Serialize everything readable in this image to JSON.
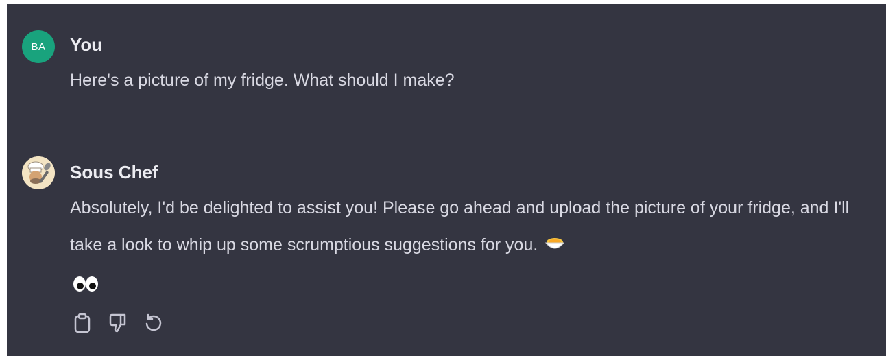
{
  "messages": {
    "user": {
      "avatar_initials": "BA",
      "author": "You",
      "text": "Here's a picture of my fridge. What should I make?"
    },
    "bot": {
      "author": "Sous Chef",
      "text": "Absolutely, I'd be delighted to assist you! Please go ahead and upload the picture of your fridge, and I'll take a look to whip up some scrumptious suggestions for you.",
      "emoji_inline": "cooking-bowl-emoji",
      "emoji_after": "eyes-emoji"
    }
  },
  "actions": [
    "copy-icon",
    "thumbs-down-icon",
    "regenerate-icon"
  ],
  "colors": {
    "panel_background": "#343541",
    "user_avatar": "#19a37d",
    "author_text": "#ececf1",
    "body_text": "#d9d9e3",
    "icon": "#c5c5d2"
  }
}
